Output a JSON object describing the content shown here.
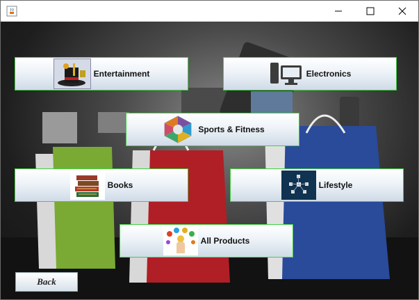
{
  "window": {
    "icon": "java-coffee-icon",
    "controls": [
      "minimize-icon",
      "maximize-icon",
      "close-icon"
    ]
  },
  "categories": {
    "entertainment": {
      "label": "Entertainment",
      "icon": "magic-hat-icon"
    },
    "electronics": {
      "label": "Electronics",
      "icon": "desktop-computer-icon"
    },
    "sports": {
      "label": "Sports & Fitness",
      "icon": "sports-hexagon-icon"
    },
    "books": {
      "label": "Books",
      "icon": "book-stack-icon"
    },
    "lifestyle": {
      "label": "Lifestyle",
      "icon": "lifestyle-network-icon"
    },
    "all": {
      "label": "All Products",
      "icon": "products-hand-icon"
    }
  },
  "back_label": "Back",
  "colors": {
    "button_border": "#3fd13f",
    "bag_green": "#6a9a2a",
    "bag_red": "#b01f25",
    "bag_blue": "#2a4a9a"
  }
}
